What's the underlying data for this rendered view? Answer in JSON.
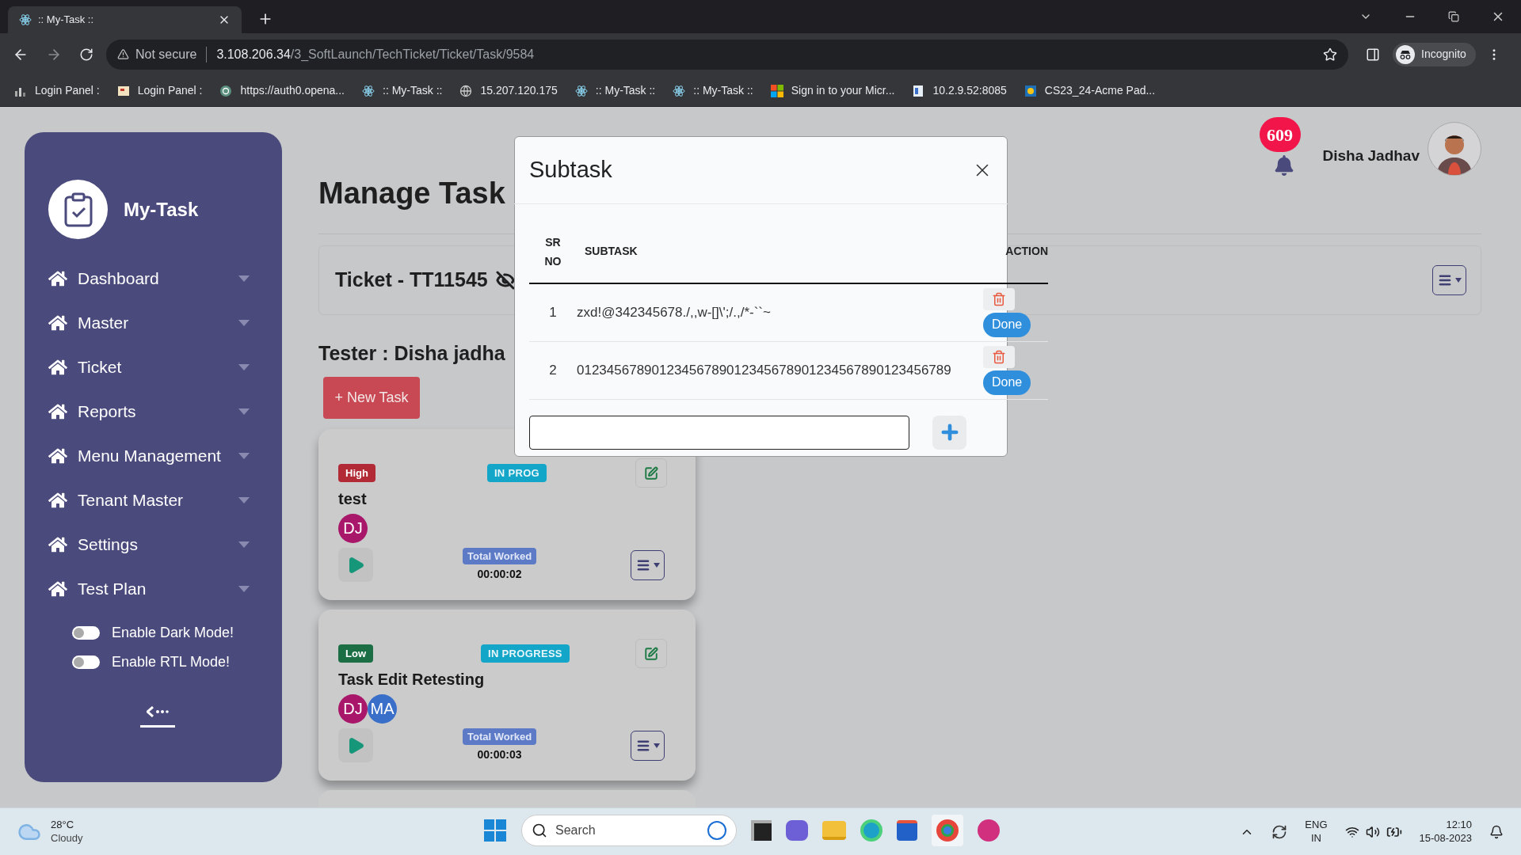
{
  "browser": {
    "tab_title": ":: My-Task ::",
    "security": "Not secure",
    "url_host": "3.108.206.34",
    "url_path": "/3_SoftLaunch/TechTicket/Ticket/Task/9584",
    "profile": "Incognito",
    "bookmarks": [
      {
        "label": "Login Panel :",
        "kind": "bars"
      },
      {
        "label": "Login Panel :",
        "kind": "page"
      },
      {
        "label": "https://auth0.opena...",
        "kind": "spiral"
      },
      {
        "label": ":: My-Task ::",
        "kind": "atom"
      },
      {
        "label": "15.207.120.175",
        "kind": "globe"
      },
      {
        "label": ":: My-Task ::",
        "kind": "atom"
      },
      {
        "label": ":: My-Task ::",
        "kind": "atom"
      },
      {
        "label": "Sign in to your Micr...",
        "kind": "squares"
      },
      {
        "label": "10.2.9.52:8085",
        "kind": "doc"
      },
      {
        "label": "CS23_24-Acme Pad...",
        "kind": "app"
      }
    ]
  },
  "sidebar": {
    "brand": "My-Task",
    "items": [
      {
        "label": "Dashboard"
      },
      {
        "label": "Master"
      },
      {
        "label": "Ticket"
      },
      {
        "label": "Reports"
      },
      {
        "label": "Menu Management"
      },
      {
        "label": "Tenant Master"
      },
      {
        "label": "Settings"
      },
      {
        "label": "Test Plan"
      }
    ],
    "toggles": [
      {
        "label": "Enable Dark Mode!",
        "on": false
      },
      {
        "label": "Enable RTL Mode!",
        "on": false
      }
    ]
  },
  "header": {
    "notification_count": "609",
    "user_name": "Disha Jadhav"
  },
  "main": {
    "title": "Manage Task",
    "ticket": "Ticket - TT11545",
    "tester": "Tester : Disha jadha",
    "new_task_button": "+ New Task",
    "tasks": [
      {
        "priority": {
          "label": "High",
          "color": "#b12a36"
        },
        "status": "IN PROG",
        "title": "test",
        "assignees": [
          {
            "initials": "DJ",
            "color": "#a8176a"
          }
        ],
        "worked_label": "Total Worked",
        "worked": "00:00:02"
      },
      {
        "priority": {
          "label": "Low",
          "color": "#1c6e44"
        },
        "status": "IN PROGRESS",
        "title": "Task Edit Retesting",
        "assignees": [
          {
            "initials": "DJ",
            "color": "#a8176a"
          },
          {
            "initials": "MA",
            "color": "#3a6fc9"
          }
        ],
        "worked_label": "Total Worked",
        "worked": "00:00:03"
      }
    ]
  },
  "modal": {
    "title": "Subtask",
    "columns": [
      "SR NO",
      "SUBTASK",
      "ACTION"
    ],
    "rows": [
      {
        "sr": "1",
        "subtask": "zxd!@342345678./,,w-[]\\';/.,/*-``~",
        "action": "Done"
      },
      {
        "sr": "2",
        "subtask": "01234567890123456789012345678901234567890123456789",
        "action": "Done"
      }
    ]
  },
  "taskbar": {
    "temperature": "28°C",
    "weather": "Cloudy",
    "search_placeholder": "Search",
    "language": "ENG",
    "region": "IN",
    "time": "12:10",
    "date": "15-08-2023"
  }
}
